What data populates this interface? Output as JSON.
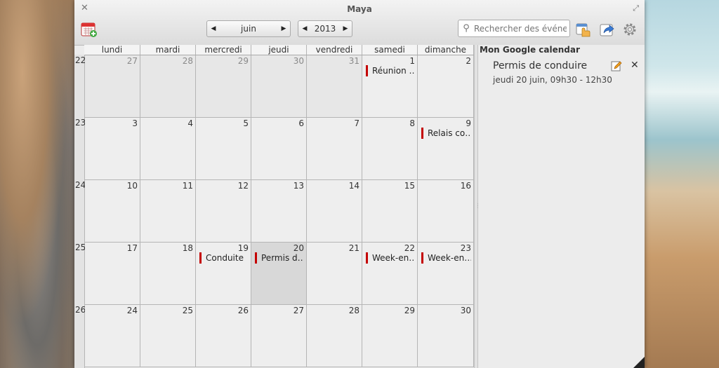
{
  "window": {
    "title": "Maya"
  },
  "toolbar": {
    "month": "juin",
    "year": "2013",
    "search_placeholder": "Rechercher des événements"
  },
  "calendar": {
    "day_names": [
      "lundi",
      "mardi",
      "mercredi",
      "jeudi",
      "vendredi",
      "samedi",
      "dimanche"
    ],
    "week_numbers": [
      "22",
      "23",
      "24",
      "25",
      "26"
    ],
    "weeks": [
      [
        {
          "day": "27",
          "other": true
        },
        {
          "day": "28",
          "other": true
        },
        {
          "day": "29",
          "other": true
        },
        {
          "day": "30",
          "other": true
        },
        {
          "day": "31",
          "other": true
        },
        {
          "day": "1",
          "event": "Réunion …"
        },
        {
          "day": "2"
        }
      ],
      [
        {
          "day": "3"
        },
        {
          "day": "4"
        },
        {
          "day": "5"
        },
        {
          "day": "6"
        },
        {
          "day": "7"
        },
        {
          "day": "8"
        },
        {
          "day": "9",
          "event": "Relais co…"
        }
      ],
      [
        {
          "day": "10"
        },
        {
          "day": "11"
        },
        {
          "day": "12"
        },
        {
          "day": "13"
        },
        {
          "day": "14"
        },
        {
          "day": "15"
        },
        {
          "day": "16"
        }
      ],
      [
        {
          "day": "17"
        },
        {
          "day": "18"
        },
        {
          "day": "19",
          "event": "Conduite"
        },
        {
          "day": "20",
          "event": "Permis d…",
          "today": true
        },
        {
          "day": "21"
        },
        {
          "day": "22",
          "event": "Week-en…"
        },
        {
          "day": "23",
          "event": "Week-en…"
        }
      ],
      [
        {
          "day": "24"
        },
        {
          "day": "25"
        },
        {
          "day": "26"
        },
        {
          "day": "27"
        },
        {
          "day": "28"
        },
        {
          "day": "29"
        },
        {
          "day": "30"
        }
      ]
    ]
  },
  "sidebar": {
    "calendar_name": "Mon Google calendar",
    "event_title": "Permis de conduire",
    "event_time": "jeudi 20 juin, 09h30 - 12h30"
  },
  "colors": {
    "event_marker": "#c40000",
    "selected_day": "#d8d8d8"
  }
}
